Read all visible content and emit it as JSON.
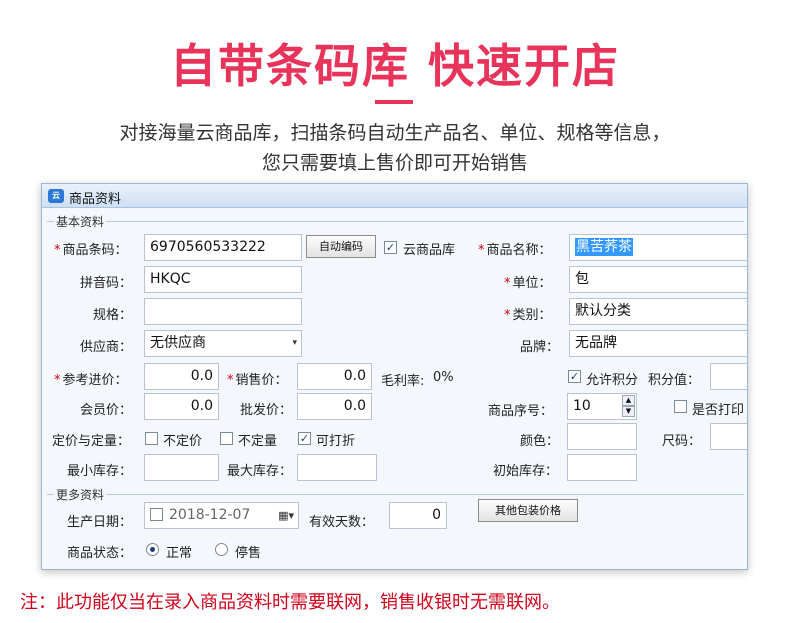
{
  "banner": {
    "title": "自带条码库 快速开店",
    "desc_line1": "对接海量云商品库，扫描条码自动生产品名、单位、规格等信息，",
    "desc_line2": "您只需要填上售价即可开始销售"
  },
  "window": {
    "title": "商品资料",
    "icon_text": "云"
  },
  "basic_section": {
    "label": "基本资料",
    "barcode_label": "商品条码：",
    "barcode_value": "6970560533222",
    "auto_code_button": "自动编码",
    "cloud_library_label": "云商品库",
    "name_label": "商品名称：",
    "name_value": "黑苦荞茶",
    "pinyin_label": "拼音码：",
    "pinyin_value": "HKQC",
    "unit_label": "单位：",
    "unit_value": "包",
    "spec_label": "规格：",
    "spec_value": "",
    "category_label": "类别：",
    "category_value": "默认分类",
    "supplier_label": "供应商：",
    "supplier_value": "无供应商",
    "brand_label": "品牌：",
    "brand_value": "无品牌",
    "ref_price_label": "参考进价：",
    "ref_price_value": "0.0",
    "sale_price_label": "销售价：",
    "sale_price_value": "0.0",
    "margin_label": "毛利率:",
    "margin_value": "0%",
    "allow_points_label": "允许积分",
    "points_value_label": "积分值：",
    "member_price_label": "会员价：",
    "member_price_value": "0.0",
    "wholesale_label": "批发价：",
    "wholesale_value": "0.0",
    "seq_label": "商品序号：",
    "seq_value": "10",
    "print_label": "是否打印",
    "pricing_label": "定价与定量：",
    "unpriced_label": "不定价",
    "unquantified_label": "不定量",
    "discount_label": "可打折",
    "color_label": "颜色：",
    "size_label": "尺码：",
    "min_stock_label": "最小库存：",
    "max_stock_label": "最大库存：",
    "init_stock_label": "初始库存："
  },
  "more_section": {
    "label": "更多资料",
    "prod_date_label": "生产日期：",
    "prod_date_value": "2018-12-07",
    "valid_days_label": "有效天数：",
    "valid_days_value": "0",
    "other_pack_button": "其他包装价格",
    "status_label": "商品状态：",
    "status_normal": "正常",
    "status_stopped": "停售"
  },
  "check_mark": "✓",
  "footnote": "注：此功能仅当在录入商品资料时需要联网，销售收银时无需联网。",
  "colors": {
    "accent": "#e8345b",
    "note": "#d0021b",
    "selection": "#3399ff"
  }
}
